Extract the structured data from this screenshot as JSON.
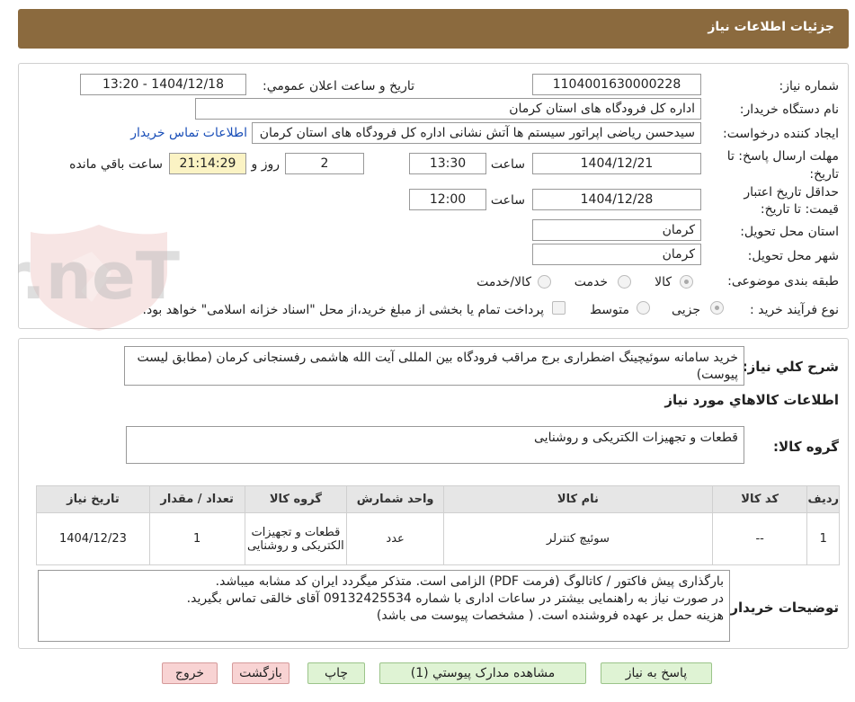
{
  "header": {
    "title": "جزئیات اطلاعات نیاز"
  },
  "fields": {
    "need_number": {
      "label": "شماره نیاز:",
      "value": "1104001630000228"
    },
    "announce": {
      "label": "تاریخ و ساعت اعلان عمومي:",
      "value": "1404/12/18 - 13:20"
    },
    "buyer_org": {
      "label": "نام دستگاه خريدار:",
      "value": "اداره کل فرودگاه های استان کرمان"
    },
    "requester": {
      "label": "ايجاد کننده درخواست:",
      "value": "سیدحسن ریاضی اپراتور سیستم ها آتش نشانی اداره کل فرودگاه های استان کرمان",
      "contact_link": "اطلاعات تماس خریدار"
    },
    "send_deadline": {
      "label_line1": "مهلت ارسال پاسخ: تا",
      "label_line2": "تاريخ:",
      "date": "1404/12/21",
      "time_label": "ساعت",
      "time": "13:30",
      "days": "2",
      "days_label": "روز و",
      "remaining": "21:14:29",
      "remaining_label": "ساعت باقي مانده"
    },
    "price_validity": {
      "label_line1": "حداقل تاريخ اعتبار",
      "label_line2": "قيمت: تا تاريخ:",
      "date": "1404/12/28",
      "time_label": "ساعت",
      "time": "12:00"
    },
    "province": {
      "label": "استان محل تحويل:",
      "value": "کرمان"
    },
    "city": {
      "label": "شهر محل تحويل:",
      "value": "کرمان"
    },
    "category": {
      "label": "طبقه بندی موضوعی:",
      "options": [
        "کالا",
        "خدمت",
        "کالا/خدمت"
      ]
    },
    "process": {
      "label": "نوع فرآیند خرید :",
      "options": [
        "جزیی",
        "متوسط"
      ],
      "payment_note": "پرداخت تمام یا بخشی از مبلغ خرید،از محل \"اسناد خزانه اسلامی\" خواهد بود."
    }
  },
  "description": {
    "label": "شرح کلي نياز:",
    "value": "خرید سامانه سوئیچینگ اضطراری برج مراقب فرودگاه بین المللی آیت الله هاشمی رفسنجانی کرمان (مطابق لیست پیوست)"
  },
  "goods_info": {
    "title": "اطلاعات کالاهاي مورد نياز",
    "group_label": "گروه کالا:",
    "group_value": "قطعات و تجهیزات الکتریکی و روشنایی"
  },
  "table": {
    "headers": [
      "رديف",
      "کد کالا",
      "نام کالا",
      "واحد شمارش",
      "گروه کالا",
      "تعداد / مقدار",
      "تاريخ نياز"
    ],
    "rows": [
      {
        "row": "1",
        "code": "--",
        "name": "سوئیچ کنترلر",
        "unit": "عدد",
        "group": "قطعات و تجهیزات الکتریکی و روشنایی",
        "qty": "1",
        "date": "1404/12/23"
      }
    ]
  },
  "buyer_notes": {
    "label": "توضيحات خريدار:",
    "lines": [
      "بارگذاری پیش فاکتور / کاتالوگ (فرمت PDF) الزامی است. متذکر میگردد ایران کد مشابه میباشد.",
      "در صورت نیاز به راهنمایی بیشتر در ساعات اداری با شماره 09132425534 آقای خالقی تماس بگیرید.",
      "هزینه حمل بر عهده فروشنده است. ( مشخصات پیوست می باشد)"
    ]
  },
  "buttons": {
    "reply": "پاسخ به نياز",
    "attachments": "مشاهده مدارک پيوستي (1)",
    "print": "چاپ",
    "back": "بازگشت",
    "exit": "خروج"
  },
  "watermark": {
    "text": "AriaTender.neT"
  },
  "colors": {
    "header": "#8b6a3e",
    "green_button": "#dff3d4",
    "red_button": "#f8d3d3",
    "link": "#1a4fb8",
    "remaining_bg": "#fbf3c4"
  }
}
